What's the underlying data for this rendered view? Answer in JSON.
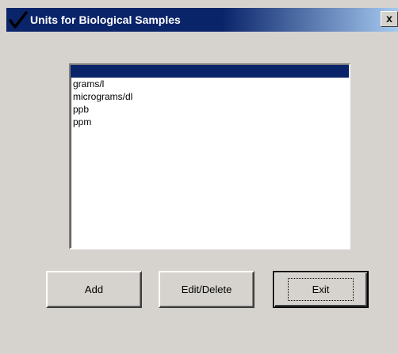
{
  "window": {
    "title": "Units for Biological Samples",
    "close_glyph": "x",
    "title_icon": "checkmark-icon"
  },
  "list": {
    "items": [
      "",
      "grams/l",
      "micrograms/dl",
      "ppb",
      "ppm"
    ],
    "selected_index": 0
  },
  "buttons": {
    "add_label": "Add",
    "edit_label": "Edit/Delete",
    "exit_label": "Exit"
  },
  "colors": {
    "title_bar": "#0a246a",
    "selection": "#0a246a",
    "face": "#d6d3ce"
  }
}
